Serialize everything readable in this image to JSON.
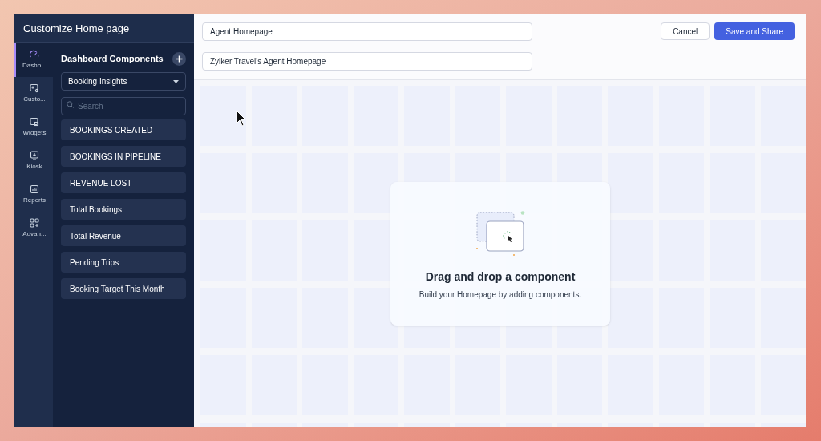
{
  "window": {
    "title": "Customize Home page"
  },
  "rail": [
    {
      "label": "Dashb...",
      "kind": "gauge",
      "selected": true
    },
    {
      "label": "Custo...",
      "kind": "custom",
      "selected": false
    },
    {
      "label": "Widgets",
      "kind": "widget",
      "selected": false
    },
    {
      "label": "Kiosk",
      "kind": "kiosk",
      "selected": false
    },
    {
      "label": "Reports",
      "kind": "report",
      "selected": false
    },
    {
      "label": "Advan...",
      "kind": "advanced",
      "selected": false
    }
  ],
  "panel": {
    "title": "Dashboard Components",
    "dropdown": "Booking Insights",
    "search": {
      "placeholder": "Search"
    },
    "components": [
      "BOOKINGS CREATED",
      "BOOKINGS IN PIPELINE",
      "REVENUE LOST",
      "Total Bookings",
      "Total Revenue",
      "Pending Trips",
      "Booking Target This Month"
    ]
  },
  "header": {
    "name_field": "Agent Homepage",
    "description_field": "Zylker Travel's Agent Homepage",
    "buttons": [
      {
        "label": "Cancel",
        "kind": "secondary"
      },
      {
        "label": "Save and Share",
        "kind": "primary"
      }
    ]
  },
  "empty_state": {
    "title": "Drag and drop a component",
    "subtitle": "Build your Homepage by adding components."
  }
}
